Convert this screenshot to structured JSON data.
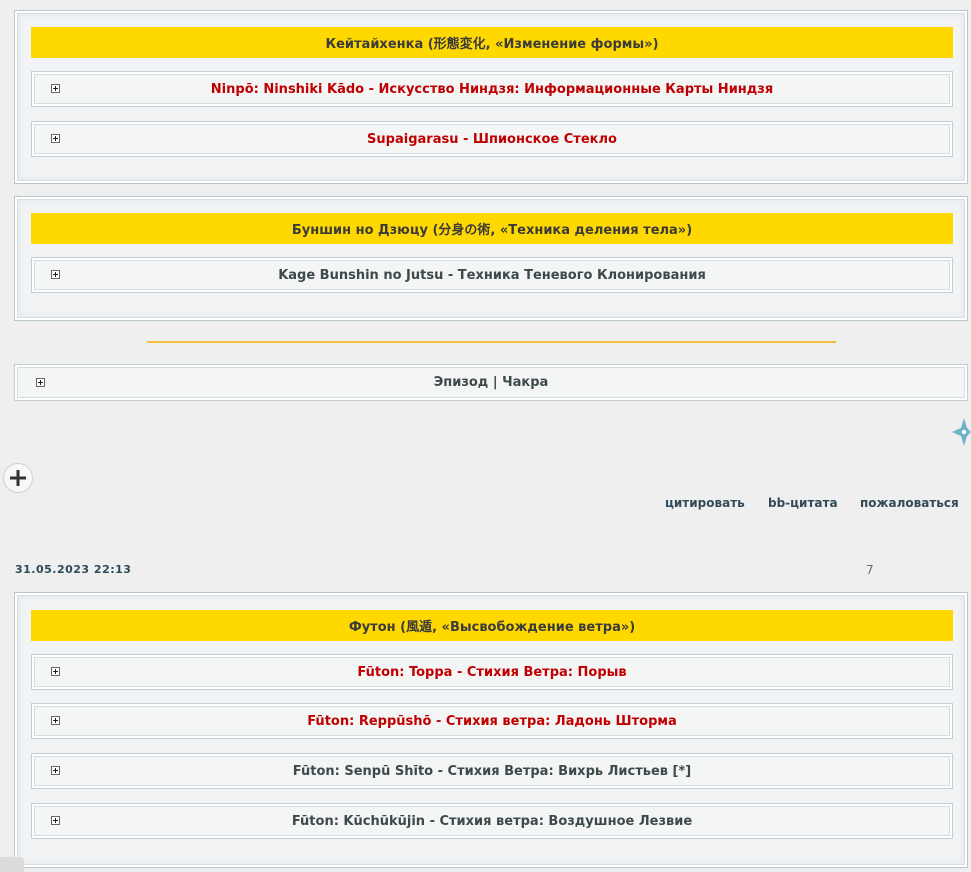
{
  "colors": {
    "header_bg": "#ffd800",
    "red_link": "#c00000",
    "separator": "#f4be3a"
  },
  "blocks": [
    {
      "header": "Кейтайхенка (形態変化, «Изменение формы»)",
      "items": [
        {
          "text": "Ninpō: Ninshiki Kādo - Искусство Ниндзя: Информационные Карты Ниндзя",
          "style": "red"
        },
        {
          "text": "Supaigarasu - Шпионское Стекло",
          "style": "red"
        }
      ]
    },
    {
      "header": "Буншин но Дзюцу (分身の術, «Техника деления тела»)",
      "items": [
        {
          "text": "Kage Bunshin no Jutsu - Техника Теневого Клонирования",
          "style": "gray"
        }
      ]
    }
  ],
  "episode": "Эпизод | Чакра",
  "actions": {
    "quote": "цитировать",
    "bb_quote": "bb-цитата",
    "report": "пожаловаться"
  },
  "post": {
    "date": "31.05.2023 22:13",
    "number": "7"
  },
  "futon": {
    "header": "Футон (風遁, «Высвобождение ветра»)",
    "items": [
      {
        "text": "Fūton: Toppa - Стихия Ветра: Порыв",
        "style": "red"
      },
      {
        "text": "Fūton: Reppūshō - Стихия ветра: Ладонь Шторма",
        "style": "red"
      },
      {
        "text": "Fūton: Senpū Shīto - Стихия Ветра: Вихрь Листьев [*]",
        "style": "gray"
      },
      {
        "text": "Fūton: Kūchūkūjin - Стихия ветра: Воздушное Лезвие",
        "style": "gray"
      }
    ]
  },
  "icons": {
    "expand": "plus-icon",
    "add": "add-circle-icon",
    "decor": "shuriken-icon"
  }
}
